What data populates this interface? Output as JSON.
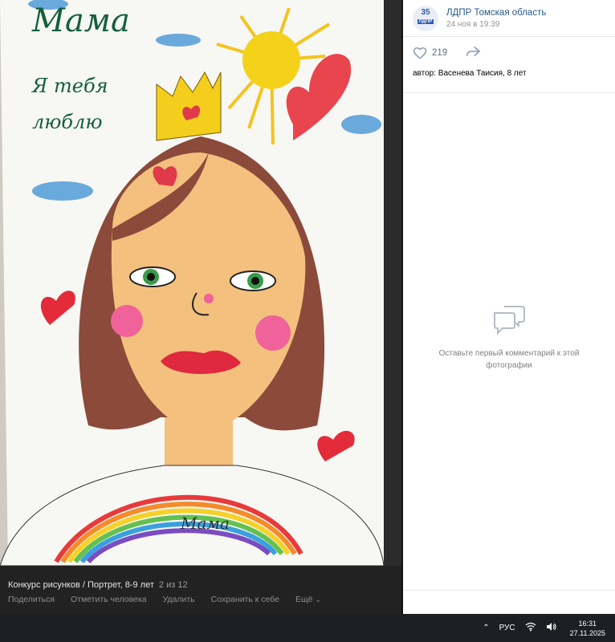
{
  "photo": {
    "caption_line1": "Мама",
    "caption_line2": "Я тебя",
    "caption_line3": "люблю",
    "signature": "Мама"
  },
  "photo_footer": {
    "album": "Конкурс рисунков / Портрет, 8-9 лет",
    "counter": "2 из 12",
    "actions": [
      "Поделиться",
      "Отметить человека",
      "Удалить",
      "Сохранить к себе",
      "Ещё"
    ]
  },
  "sidebar": {
    "group_name": "ЛДПР Томская область",
    "avatar_number": "35",
    "avatar_text": "ЛДПР",
    "post_date": "24 ноя в 19:39",
    "likes": "219",
    "author": "автор: Васенева Таисия, 8 лет",
    "empty_comments": "Оставьте первый комментарий к этой фотографии"
  },
  "taskbar": {
    "language": "РУС",
    "time": "16:31",
    "date": "27.11.2025"
  },
  "colors": {
    "link": "#2a5885",
    "taskbar": "#1c1f24",
    "footer": "#222222"
  }
}
